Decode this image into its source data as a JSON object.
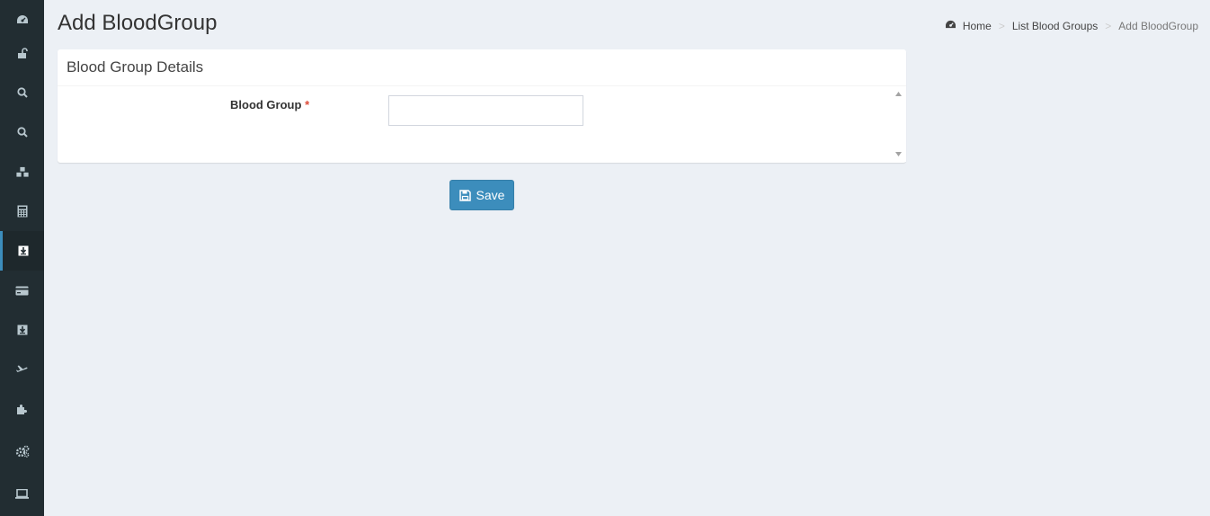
{
  "sidebar": {
    "items": [
      {
        "icon": "dashboard-icon",
        "active": false
      },
      {
        "icon": "unlock-icon",
        "active": false
      },
      {
        "icon": "search-icon",
        "active": false
      },
      {
        "icon": "search-icon",
        "active": false
      },
      {
        "icon": "cubes-icon",
        "active": false
      },
      {
        "icon": "calculator-icon",
        "active": false
      },
      {
        "icon": "download-icon",
        "active": true
      },
      {
        "icon": "credit-card-icon",
        "active": false
      },
      {
        "icon": "download-icon",
        "active": false
      },
      {
        "icon": "plane-icon",
        "active": false
      },
      {
        "icon": "puzzle-icon",
        "active": false
      },
      {
        "icon": "gears-icon",
        "active": false
      },
      {
        "icon": "laptop-icon",
        "active": false
      }
    ]
  },
  "header": {
    "title": "Add BloodGroup"
  },
  "breadcrumb": {
    "home": "Home",
    "list": "List Blood Groups",
    "current": "Add BloodGroup",
    "separator": ">"
  },
  "form": {
    "box_title": "Blood Group Details",
    "blood_group_label": "Blood Group",
    "required_mark": "*",
    "blood_group_value": ""
  },
  "actions": {
    "save_label": "Save"
  },
  "colors": {
    "sidebar_bg": "#222d32",
    "accent": "#3c8dbc",
    "page_bg": "#ecf0f5",
    "required": "#dd4b39"
  }
}
